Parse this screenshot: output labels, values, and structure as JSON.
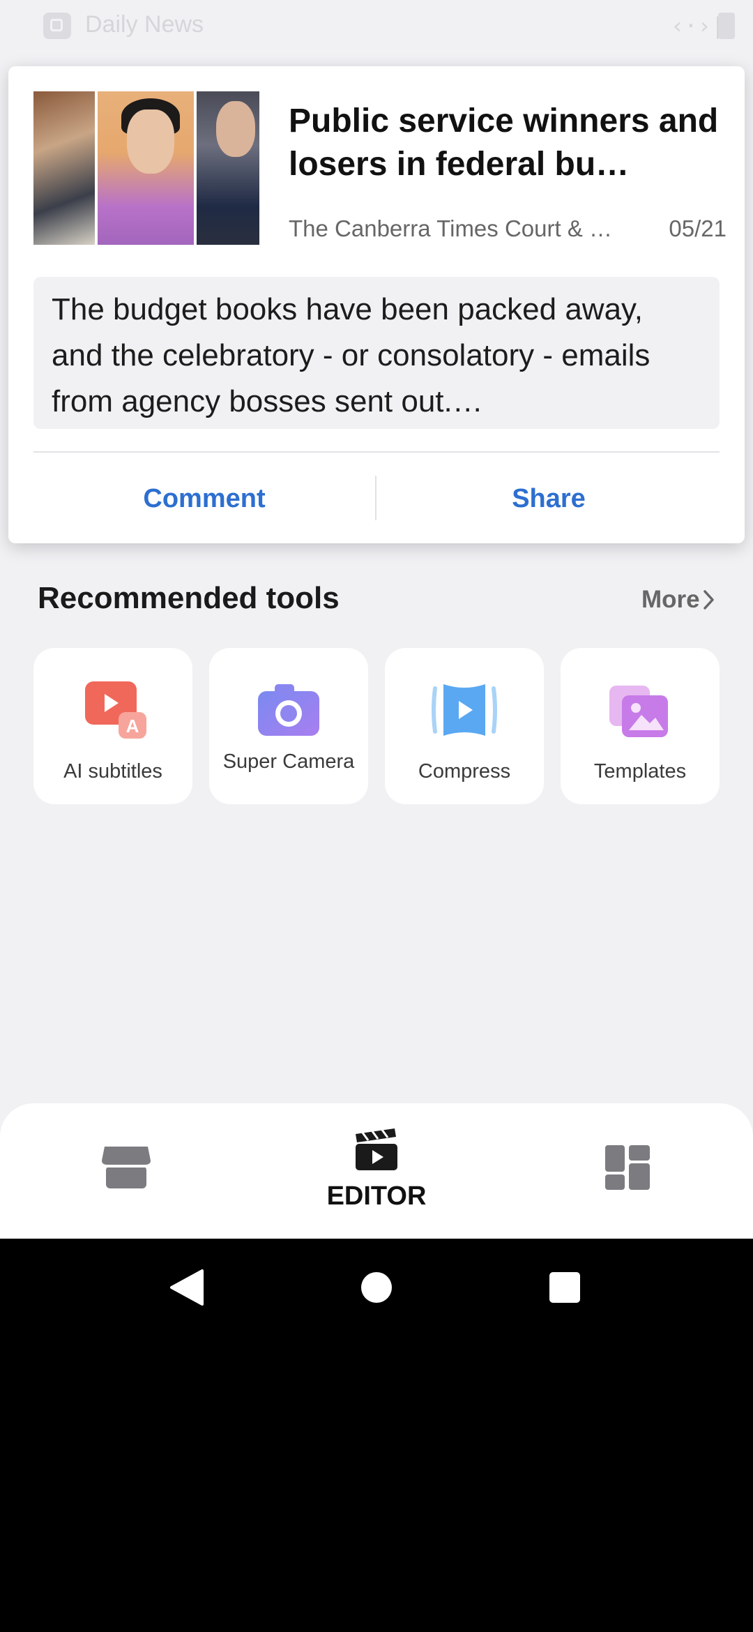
{
  "status_bar": {
    "app_title": "Daily News",
    "code_icon": "code-icon",
    "battery_icon": "battery-icon"
  },
  "news_popup": {
    "title": "Public service winners and losers in federal bu…",
    "source": "The Canberra Times Court & …",
    "date": "05/21",
    "summary": "The budget books have been packed away, and the celebratory - or consolatory - emails from agency bosses sent out.…",
    "comment_label": "Comment",
    "share_label": "Share",
    "accent_color": "#2d6fd0"
  },
  "recommended_tools": {
    "title": "Recommended tools",
    "more_label": "More",
    "items": [
      {
        "label": "AI subtitles",
        "icon": "ai-subtitles-icon"
      },
      {
        "label": "Super Camera",
        "icon": "camera-icon"
      },
      {
        "label": "Compress",
        "icon": "compress-icon"
      },
      {
        "label": "Templates",
        "icon": "templates-icon"
      }
    ]
  },
  "bottom_nav": {
    "items": [
      {
        "icon": "store-icon"
      },
      {
        "label": "EDITOR",
        "icon": "clapperboard-icon",
        "selected": true
      },
      {
        "icon": "dashboard-icon"
      }
    ]
  },
  "system_nav": {
    "back": "back-icon",
    "home": "home-icon",
    "recents": "recents-icon"
  }
}
